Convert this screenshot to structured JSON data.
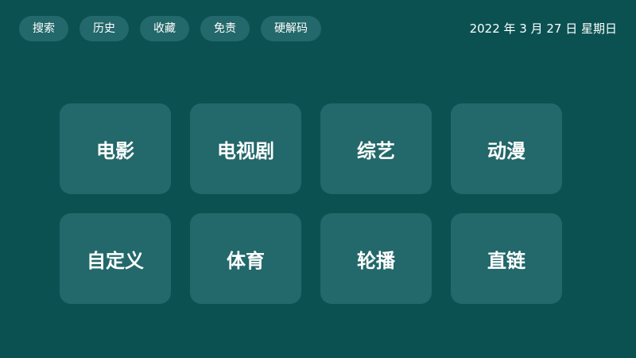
{
  "header": {
    "nav_items": [
      {
        "label": "搜索"
      },
      {
        "label": "历史"
      },
      {
        "label": "收藏"
      },
      {
        "label": "免责"
      },
      {
        "label": "硬解码"
      }
    ],
    "date_text": "2022 年 3 月 27 日 星期日"
  },
  "categories": [
    {
      "label": "电影"
    },
    {
      "label": "电视剧"
    },
    {
      "label": "综艺"
    },
    {
      "label": "动漫"
    },
    {
      "label": "自定义"
    },
    {
      "label": "体育"
    },
    {
      "label": "轮播"
    },
    {
      "label": "直链"
    }
  ],
  "colors": {
    "background": "#0b5152",
    "tile": "#23686a",
    "text": "#ffffff"
  }
}
